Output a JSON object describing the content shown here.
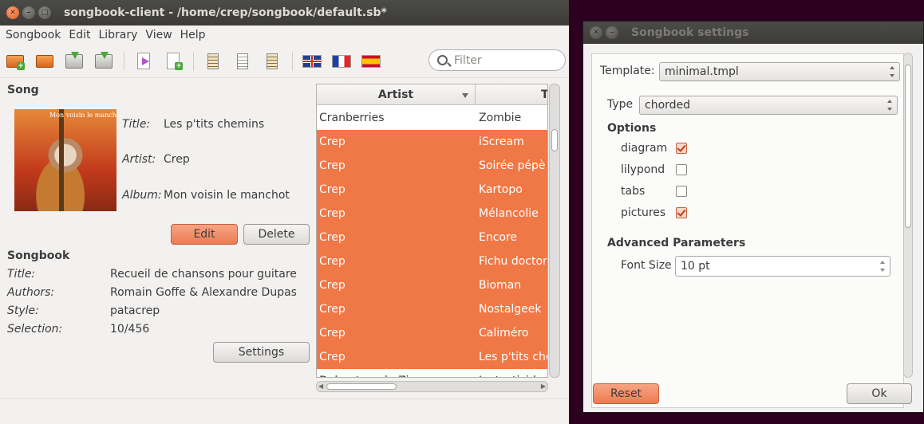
{
  "main_window": {
    "title": "songbook-client - /home/crep/songbook/default.sb*",
    "menu": [
      "Songbook",
      "Edit",
      "Library",
      "View",
      "Help"
    ],
    "toolbar_icons": [
      "new-songbook-icon",
      "open-folder-icon",
      "save-icon",
      "save-as-icon",
      "import-icon",
      "new-song-icon",
      "chords-icon",
      "lyrics-icon",
      "tabs-icon",
      "flag-en-icon",
      "flag-fr-icon",
      "flag-es-icon"
    ],
    "search_placeholder": "Filter"
  },
  "song": {
    "heading": "Song",
    "cover_text": "Mon voisin le manchot",
    "title_label": "Title:",
    "title_value": "Les p'tits chemins",
    "artist_label": "Artist:",
    "artist_value": "Crep",
    "album_label": "Album:",
    "album_value": "Mon voisin le manchot",
    "edit_button": "Edit",
    "delete_button": "Delete"
  },
  "songbook": {
    "heading": "Songbook",
    "title_label": "Title:",
    "title_value": "Recueil de chansons pour guitare",
    "authors_label": "Authors:",
    "authors_value": "Romain Goffe & Alexandre Dupas",
    "style_label": "Style:",
    "style_value": "patacrep",
    "selection_label": "Selection:",
    "selection_value": "10/456",
    "settings_button": "Settings"
  },
  "library": {
    "columns": [
      "Artist",
      "T"
    ],
    "rows": [
      {
        "artist": "Cranberries",
        "title": "Zombie",
        "selected": false
      },
      {
        "artist": "Crep",
        "title": "iScream",
        "selected": true
      },
      {
        "artist": "Crep",
        "title": "Soirée pépè",
        "selected": true
      },
      {
        "artist": "Crep",
        "title": "Kartopo",
        "selected": true
      },
      {
        "artist": "Crep",
        "title": "Mélancolie",
        "selected": true
      },
      {
        "artist": "Crep",
        "title": "Encore",
        "selected": true
      },
      {
        "artist": "Crep",
        "title": "Fichu doctora",
        "selected": true
      },
      {
        "artist": "Crep",
        "title": "Bioman",
        "selected": true
      },
      {
        "artist": "Crep",
        "title": "Nostalgeek",
        "selected": true
      },
      {
        "artist": "Crep",
        "title": "Caliméro",
        "selected": true
      },
      {
        "artist": "Crep",
        "title": "Les p'tits che",
        "selected": true
      },
      {
        "artist": "Debout sur le Zinc",
        "title": "Le testicide",
        "selected": false
      }
    ]
  },
  "settings_dialog": {
    "title": "Songbook settings",
    "template_label": "Template:",
    "template_value": "minimal.tmpl",
    "type_label": "Type",
    "type_value": "chorded",
    "options_heading": "Options",
    "options": [
      {
        "label": "diagram",
        "checked": true
      },
      {
        "label": "lilypond",
        "checked": false
      },
      {
        "label": "tabs",
        "checked": false
      },
      {
        "label": "pictures",
        "checked": true
      }
    ],
    "advanced_heading": "Advanced Parameters",
    "font_size_label": "Font Size",
    "font_size_value": "10 pt",
    "reset_button": "Reset",
    "ok_button": "Ok"
  },
  "colors": {
    "accent": "#f07746",
    "titlebar": "#3c3b37",
    "desktop": "#2c001e"
  }
}
